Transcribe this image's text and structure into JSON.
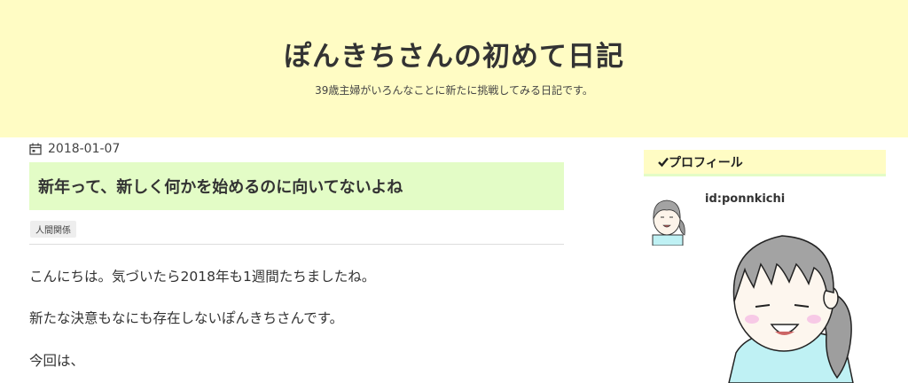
{
  "blog": {
    "title": "ぽんきちさんの初めて日記",
    "description": "39歳主婦がいろんなことに新たに挑戦してみる日記です。"
  },
  "entry": {
    "date": "2018-01-07",
    "title": "新年って、新しく何かを始めるのに向いてないよね",
    "category": "人間関係",
    "paragraphs": [
      "こんにちは。気づいたら2018年も1週間たちましたね。",
      "新たな決意もなにも存在しないぽんきちさんです。",
      "今回は、"
    ]
  },
  "sidebar": {
    "widget_title": "プロフィール",
    "profile_id": "id:ponnkichi"
  },
  "icons": {
    "date": "calendar-icon",
    "widget": "checkmark-icon"
  },
  "colors": {
    "header_bg": "#fffcc4",
    "title_bg": "#e3fcc6"
  }
}
